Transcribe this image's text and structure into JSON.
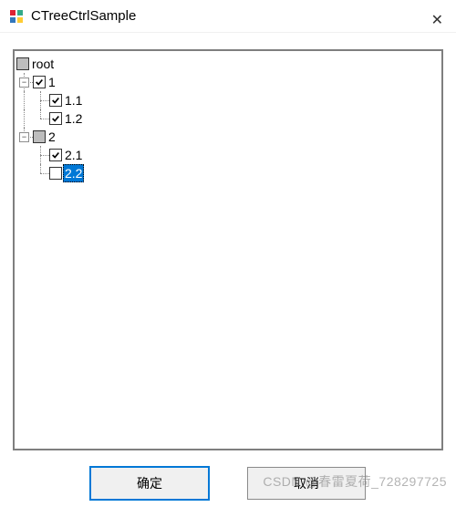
{
  "window": {
    "title": "CTreeCtrlSample",
    "icon": "app-icon",
    "close_glyph": "✕"
  },
  "tree": {
    "root": {
      "label": "root",
      "state": "indeterminate"
    },
    "item1": {
      "label": "1",
      "state": "checked",
      "toggle": "−"
    },
    "item1_1": {
      "label": "1.1",
      "state": "checked"
    },
    "item1_2": {
      "label": "1.2",
      "state": "checked"
    },
    "item2": {
      "label": "2",
      "state": "indeterminate",
      "toggle": "−"
    },
    "item2_1": {
      "label": "2.1",
      "state": "checked"
    },
    "item2_2": {
      "label": "2.2",
      "state": "unchecked",
      "selected": true
    }
  },
  "buttons": {
    "ok": "确定",
    "cancel": "取消"
  },
  "watermark": "CSDN @春雷夏荷_728297725"
}
